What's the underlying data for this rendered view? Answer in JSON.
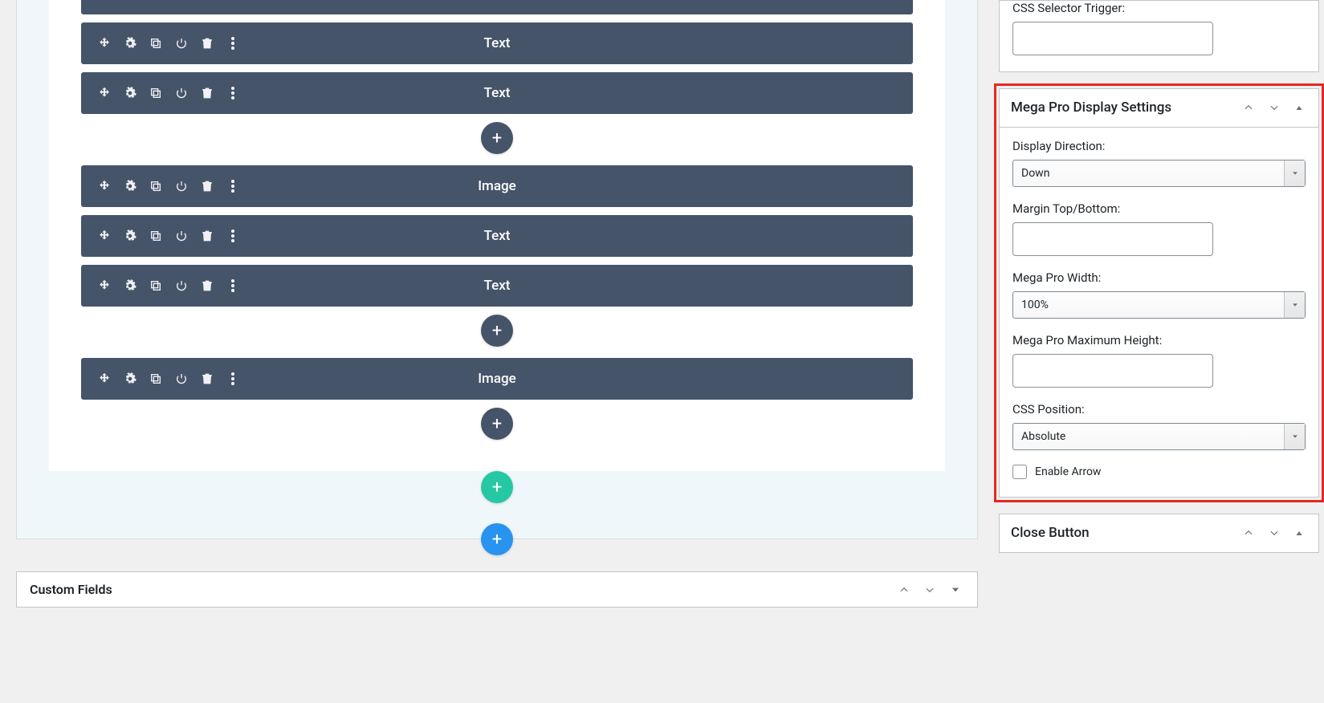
{
  "builder": {
    "blocks": [
      {
        "label": ""
      },
      {
        "label": "Text"
      },
      {
        "label": "Text"
      },
      {
        "addAfter": true
      },
      {
        "label": "Image"
      },
      {
        "label": "Text"
      },
      {
        "label": "Text"
      },
      {
        "addAfter": true
      },
      {
        "label": "Image"
      },
      {
        "addAfter": true
      }
    ]
  },
  "sidebar": {
    "cssTrigger": {
      "label": "CSS Selector Trigger:",
      "value": ""
    },
    "megaDisplay": {
      "title": "Mega Pro Display Settings",
      "direction": {
        "label": "Display Direction:",
        "value": "Down"
      },
      "margin": {
        "label": "Margin Top/Bottom:",
        "value": ""
      },
      "width": {
        "label": "Mega Pro Width:",
        "value": "100%"
      },
      "maxHeight": {
        "label": "Mega Pro Maximum Height:",
        "value": ""
      },
      "cssPosition": {
        "label": "CSS Position:",
        "value": "Absolute"
      },
      "enableArrow": {
        "label": "Enable Arrow",
        "checked": false
      }
    },
    "closeBtnPanel": {
      "title": "Close Button"
    }
  },
  "customFields": {
    "title": "Custom Fields"
  }
}
